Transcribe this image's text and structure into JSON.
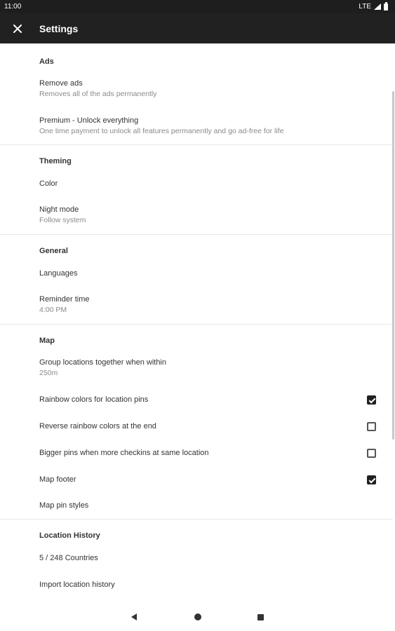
{
  "status_bar": {
    "time": "11:00",
    "network": "LTE"
  },
  "app_bar": {
    "title": "Settings"
  },
  "sections": {
    "ads": {
      "header": "Ads",
      "remove_ads": {
        "title": "Remove ads",
        "summary": "Removes all of the ads permanently"
      },
      "premium": {
        "title": "Premium - Unlock everything",
        "summary": "One time payment to unlock all features permanently and go ad-free for life"
      }
    },
    "theming": {
      "header": "Theming",
      "color": {
        "title": "Color"
      },
      "night_mode": {
        "title": "Night mode",
        "summary": "Follow system"
      }
    },
    "general": {
      "header": "General",
      "languages": {
        "title": "Languages"
      },
      "reminder": {
        "title": "Reminder time",
        "summary": "4:00 PM"
      }
    },
    "map": {
      "header": "Map",
      "group": {
        "title": "Group locations together when within",
        "summary": "250m"
      },
      "rainbow": {
        "title": "Rainbow colors for location pins",
        "checked": true
      },
      "reverse_rainbow": {
        "title": "Reverse rainbow colors at the end",
        "checked": false
      },
      "bigger_pins": {
        "title": "Bigger pins when more checkins at same location",
        "checked": false
      },
      "map_footer": {
        "title": "Map footer",
        "checked": true
      },
      "pin_styles": {
        "title": "Map pin styles"
      }
    },
    "location_history": {
      "header": "Location History",
      "countries": {
        "title": "5 / 248 Countries"
      },
      "import": {
        "title": "Import location history"
      }
    }
  },
  "colors": {
    "app_bar": "#212121",
    "status_bar": "#1e1e1e",
    "checkbox_checked": "#202020"
  }
}
